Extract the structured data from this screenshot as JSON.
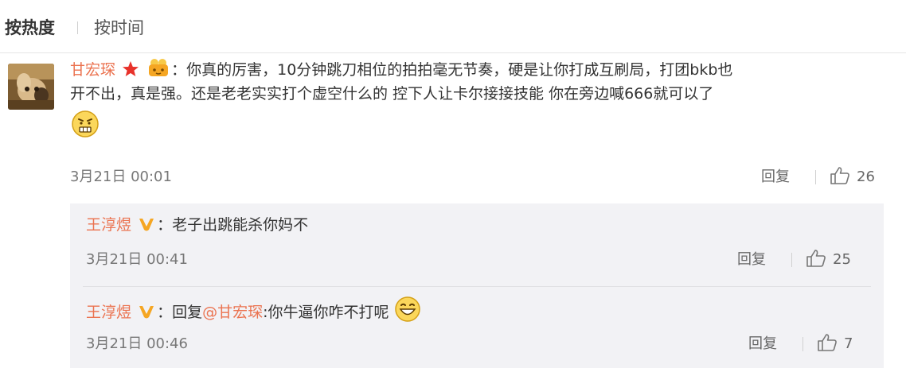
{
  "sort_bar": {
    "hot": "按热度",
    "time": "按时间"
  },
  "comment": {
    "username": "甘宏琛",
    "text_line1": "：你真的厉害，10分钟跳刀相位的拍拍毫无节奏，硬是让你打成互刷局，打团bkb也",
    "text_line2": "开不出，真是强。还是老老实实打个虚空什么的 控下人让卡尔接接技能 你在旁边喊666就可以了",
    "time": "3月21日 00:01",
    "reply_label": "回复",
    "likes": "26"
  },
  "replies": [
    {
      "username": "王淳煜",
      "text": "：老子出跳能杀你妈不",
      "time": "3月21日 00:41",
      "reply_label": "回复",
      "likes": "25"
    },
    {
      "username": "王淳煜",
      "prefix": "：回复",
      "mention": "@甘宏琛",
      "text": ":你牛逼你咋不打呢",
      "time": "3月21日 00:46",
      "reply_label": "回复",
      "likes": "7"
    }
  ],
  "colors": {
    "username": "#eb7350",
    "text": "#333333",
    "meta": "#777777",
    "reply_bg": "#f2f2f5",
    "vip_badge": "#f5a623",
    "star": "#e8322b"
  },
  "icons": [
    "star-icon",
    "membership-badge-icon",
    "verified-v-icon",
    "thumbs-up-icon",
    "awkward-face-emoji",
    "grin-emoji"
  ]
}
